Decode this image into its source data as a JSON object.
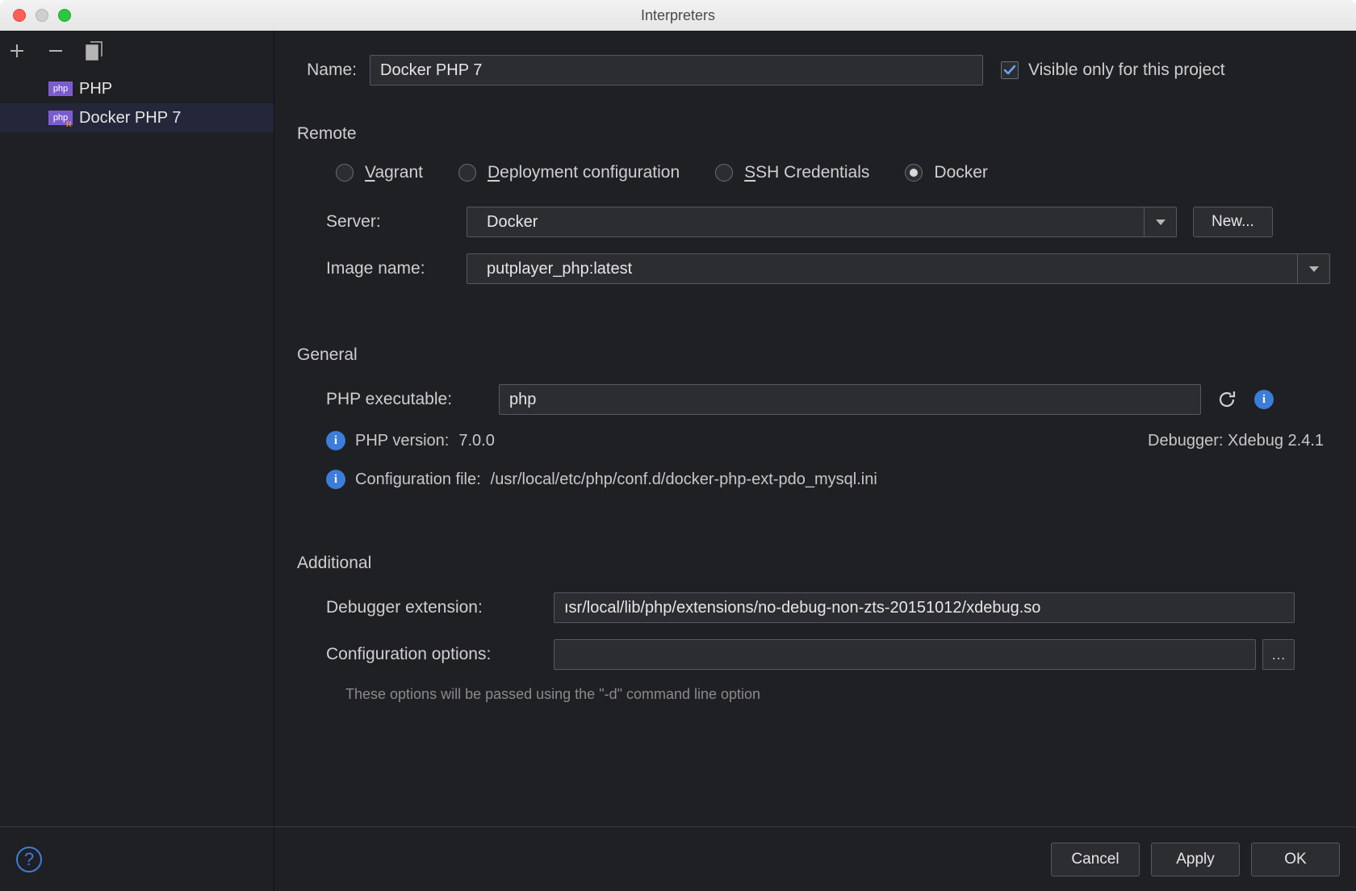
{
  "window": {
    "title": "Interpreters"
  },
  "sidebar": {
    "items": [
      {
        "label": "PHP"
      },
      {
        "label": "Docker PHP 7"
      }
    ]
  },
  "name": {
    "label": "Name:",
    "value": "Docker PHP 7"
  },
  "visible_checkbox": {
    "checked": true,
    "label": "Visible only for this project"
  },
  "remote": {
    "section": "Remote",
    "options": {
      "vagrant": "Vagrant",
      "deployment": "Deployment configuration",
      "ssh": "SSH Credentials",
      "docker": "Docker"
    },
    "server_label": "Server:",
    "server_value": "Docker",
    "new_button": "New...",
    "image_label": "Image name:",
    "image_value": "putplayer_php:latest"
  },
  "general": {
    "section": "General",
    "exec_label": "PHP executable:",
    "exec_value": "php",
    "version_label": "PHP version:",
    "version_value": "7.0.0",
    "debugger_label": "Debugger:",
    "debugger_value": "Xdebug 2.4.1",
    "config_label": "Configuration file:",
    "config_value": "/usr/local/etc/php/conf.d/docker-php-ext-pdo_mysql.ini"
  },
  "additional": {
    "section": "Additional",
    "ext_label": "Debugger extension:",
    "ext_value": "ısr/local/lib/php/extensions/no-debug-non-zts-20151012/xdebug.so",
    "cfg_label": "Configuration options:",
    "cfg_value": "",
    "hint": "These options will be passed using the \"-d\" command line option"
  },
  "footer": {
    "cancel": "Cancel",
    "apply": "Apply",
    "ok": "OK"
  }
}
